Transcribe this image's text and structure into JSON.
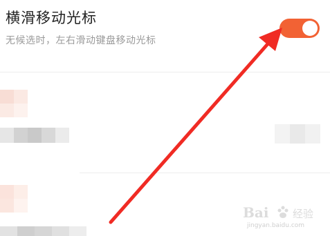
{
  "setting": {
    "title": "横滑移动光标",
    "description": "无候选时，左右滑动键盘移动光标",
    "toggle_on": true,
    "toggle_color": "#f26234"
  },
  "annotation": {
    "arrow_color": "#f02b24"
  },
  "watermark": {
    "brand": "Bai",
    "brand_cn": "经验",
    "url": "jingyan.baidu.com"
  }
}
